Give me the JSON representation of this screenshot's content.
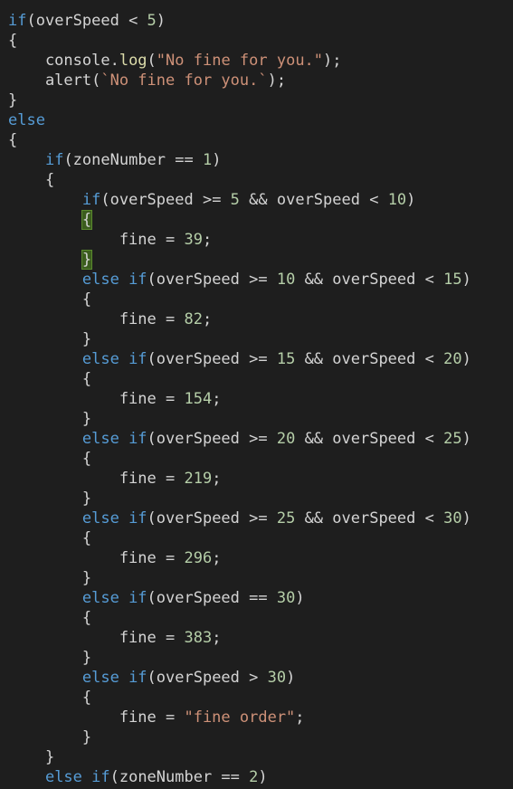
{
  "colors": {
    "background": "#1e1e1e",
    "keyword": "#569cd6",
    "plain": "#d4d4d4",
    "number": "#b5cea8",
    "string": "#ce9178",
    "method": "#dcdcaa",
    "bracket_match_bg": "#3b5c1e"
  },
  "code_lines": [
    [
      {
        "t": "keyword",
        "v": "if"
      },
      {
        "t": "plain",
        "v": "(overSpeed < "
      },
      {
        "t": "number",
        "v": "5"
      },
      {
        "t": "plain",
        "v": ")"
      }
    ],
    [
      {
        "t": "brace",
        "v": "{"
      }
    ],
    [
      {
        "t": "plain",
        "v": "    console."
      },
      {
        "t": "method",
        "v": "log"
      },
      {
        "t": "plain",
        "v": "("
      },
      {
        "t": "string",
        "v": "\"No fine for you.\""
      },
      {
        "t": "plain",
        "v": ");"
      }
    ],
    [
      {
        "t": "plain",
        "v": "    alert("
      },
      {
        "t": "string",
        "v": "`No fine for you.`"
      },
      {
        "t": "plain",
        "v": ");"
      }
    ],
    [
      {
        "t": "brace",
        "v": "}"
      }
    ],
    [
      {
        "t": "keyword",
        "v": "else"
      }
    ],
    [
      {
        "t": "brace",
        "v": "{"
      }
    ],
    [
      {
        "t": "plain",
        "v": "    "
      },
      {
        "t": "keyword",
        "v": "if"
      },
      {
        "t": "plain",
        "v": "(zoneNumber == "
      },
      {
        "t": "number",
        "v": "1"
      },
      {
        "t": "plain",
        "v": ")"
      }
    ],
    [
      {
        "t": "plain",
        "v": "    "
      },
      {
        "t": "brace",
        "v": "{"
      }
    ],
    [
      {
        "t": "plain",
        "v": "        "
      },
      {
        "t": "keyword",
        "v": "if"
      },
      {
        "t": "plain",
        "v": "(overSpeed >= "
      },
      {
        "t": "number",
        "v": "5"
      },
      {
        "t": "plain",
        "v": " && overSpeed < "
      },
      {
        "t": "number",
        "v": "10"
      },
      {
        "t": "plain",
        "v": ")"
      }
    ],
    [
      {
        "t": "plain",
        "v": "        "
      },
      {
        "t": "brace-hl",
        "v": "{"
      }
    ],
    [
      {
        "t": "plain",
        "v": "            fine = "
      },
      {
        "t": "number",
        "v": "39"
      },
      {
        "t": "plain",
        "v": ";"
      }
    ],
    [
      {
        "t": "plain",
        "v": "        "
      },
      {
        "t": "brace-hl",
        "v": "}"
      }
    ],
    [
      {
        "t": "plain",
        "v": "        "
      },
      {
        "t": "keyword",
        "v": "else if"
      },
      {
        "t": "plain",
        "v": "(overSpeed >= "
      },
      {
        "t": "number",
        "v": "10"
      },
      {
        "t": "plain",
        "v": " && overSpeed < "
      },
      {
        "t": "number",
        "v": "15"
      },
      {
        "t": "plain",
        "v": ")"
      }
    ],
    [
      {
        "t": "plain",
        "v": "        "
      },
      {
        "t": "brace",
        "v": "{"
      }
    ],
    [
      {
        "t": "plain",
        "v": "            fine = "
      },
      {
        "t": "number",
        "v": "82"
      },
      {
        "t": "plain",
        "v": ";"
      }
    ],
    [
      {
        "t": "plain",
        "v": "        "
      },
      {
        "t": "brace",
        "v": "}"
      }
    ],
    [
      {
        "t": "plain",
        "v": "        "
      },
      {
        "t": "keyword",
        "v": "else if"
      },
      {
        "t": "plain",
        "v": "(overSpeed >= "
      },
      {
        "t": "number",
        "v": "15"
      },
      {
        "t": "plain",
        "v": " && overSpeed < "
      },
      {
        "t": "number",
        "v": "20"
      },
      {
        "t": "plain",
        "v": ")"
      }
    ],
    [
      {
        "t": "plain",
        "v": "        "
      },
      {
        "t": "brace",
        "v": "{"
      }
    ],
    [
      {
        "t": "plain",
        "v": "            fine = "
      },
      {
        "t": "number",
        "v": "154"
      },
      {
        "t": "plain",
        "v": ";"
      }
    ],
    [
      {
        "t": "plain",
        "v": "        "
      },
      {
        "t": "brace",
        "v": "}"
      }
    ],
    [
      {
        "t": "plain",
        "v": "        "
      },
      {
        "t": "keyword",
        "v": "else if"
      },
      {
        "t": "plain",
        "v": "(overSpeed >= "
      },
      {
        "t": "number",
        "v": "20"
      },
      {
        "t": "plain",
        "v": " && overSpeed < "
      },
      {
        "t": "number",
        "v": "25"
      },
      {
        "t": "plain",
        "v": ")"
      }
    ],
    [
      {
        "t": "plain",
        "v": "        "
      },
      {
        "t": "brace",
        "v": "{"
      }
    ],
    [
      {
        "t": "plain",
        "v": "            fine = "
      },
      {
        "t": "number",
        "v": "219"
      },
      {
        "t": "plain",
        "v": ";"
      }
    ],
    [
      {
        "t": "plain",
        "v": "        "
      },
      {
        "t": "brace",
        "v": "}"
      }
    ],
    [
      {
        "t": "plain",
        "v": "        "
      },
      {
        "t": "keyword",
        "v": "else if"
      },
      {
        "t": "plain",
        "v": "(overSpeed >= "
      },
      {
        "t": "number",
        "v": "25"
      },
      {
        "t": "plain",
        "v": " && overSpeed < "
      },
      {
        "t": "number",
        "v": "30"
      },
      {
        "t": "plain",
        "v": ")"
      }
    ],
    [
      {
        "t": "plain",
        "v": "        "
      },
      {
        "t": "brace",
        "v": "{"
      }
    ],
    [
      {
        "t": "plain",
        "v": "            fine = "
      },
      {
        "t": "number",
        "v": "296"
      },
      {
        "t": "plain",
        "v": ";"
      }
    ],
    [
      {
        "t": "plain",
        "v": "        "
      },
      {
        "t": "brace",
        "v": "}"
      }
    ],
    [
      {
        "t": "plain",
        "v": "        "
      },
      {
        "t": "keyword",
        "v": "else if"
      },
      {
        "t": "plain",
        "v": "(overSpeed == "
      },
      {
        "t": "number",
        "v": "30"
      },
      {
        "t": "plain",
        "v": ")"
      }
    ],
    [
      {
        "t": "plain",
        "v": "        "
      },
      {
        "t": "brace",
        "v": "{"
      }
    ],
    [
      {
        "t": "plain",
        "v": "            fine = "
      },
      {
        "t": "number",
        "v": "383"
      },
      {
        "t": "plain",
        "v": ";"
      }
    ],
    [
      {
        "t": "plain",
        "v": "        "
      },
      {
        "t": "brace",
        "v": "}"
      }
    ],
    [
      {
        "t": "plain",
        "v": "        "
      },
      {
        "t": "keyword",
        "v": "else if"
      },
      {
        "t": "plain",
        "v": "(overSpeed > "
      },
      {
        "t": "number",
        "v": "30"
      },
      {
        "t": "plain",
        "v": ")"
      }
    ],
    [
      {
        "t": "plain",
        "v": "        "
      },
      {
        "t": "brace",
        "v": "{"
      }
    ],
    [
      {
        "t": "plain",
        "v": "            fine = "
      },
      {
        "t": "string",
        "v": "\"fine order\""
      },
      {
        "t": "plain",
        "v": ";"
      }
    ],
    [
      {
        "t": "plain",
        "v": "        "
      },
      {
        "t": "brace",
        "v": "}"
      }
    ],
    [
      {
        "t": "plain",
        "v": "    "
      },
      {
        "t": "brace",
        "v": "}"
      }
    ],
    [
      {
        "t": "plain",
        "v": "    "
      },
      {
        "t": "keyword",
        "v": "else if"
      },
      {
        "t": "plain",
        "v": "(zoneNumber == "
      },
      {
        "t": "number",
        "v": "2"
      },
      {
        "t": "plain",
        "v": ")"
      }
    ]
  ]
}
